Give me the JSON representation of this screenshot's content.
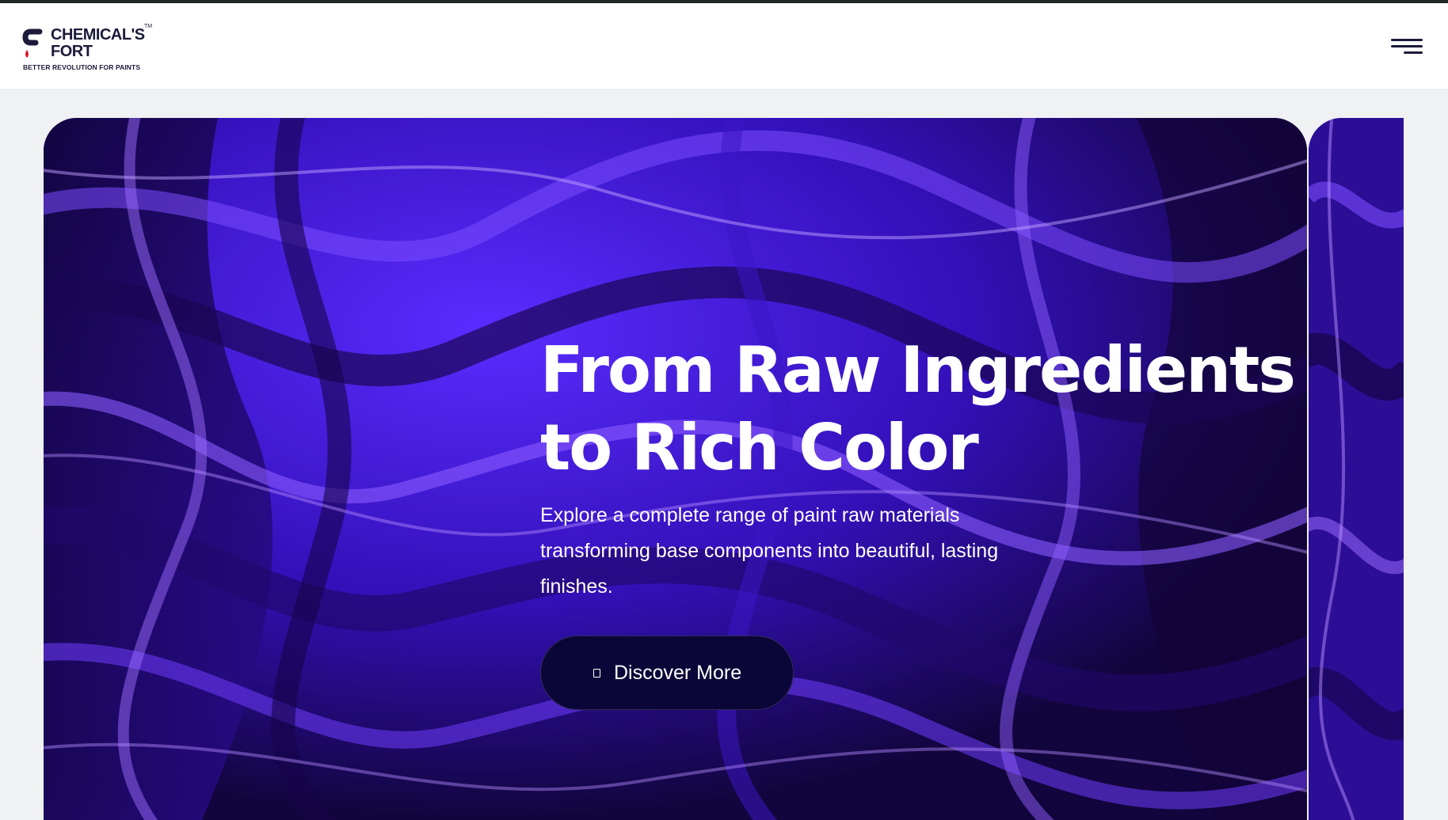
{
  "header": {
    "logo": {
      "name_line1": "CHEMICAL'S",
      "name_line2": "FORT",
      "trademark": "TM",
      "tagline": "BETTER REVOLUTION FOR PAINTS"
    },
    "menu_icon": "hamburger-menu-icon"
  },
  "hero": {
    "title_line1": "From Raw Ingredients",
    "title_line2": "to Rich Color",
    "description": "Explore a complete range of paint raw materials transforming base components into beautiful, lasting finishes.",
    "cta_label": "Discover More",
    "cta_icon": "square-icon"
  },
  "colors": {
    "brand_dark": "#1c1b3a",
    "accent_red": "#e0182d",
    "cta_background": "#0b0638",
    "hero_purple": "#4a1fe0"
  }
}
